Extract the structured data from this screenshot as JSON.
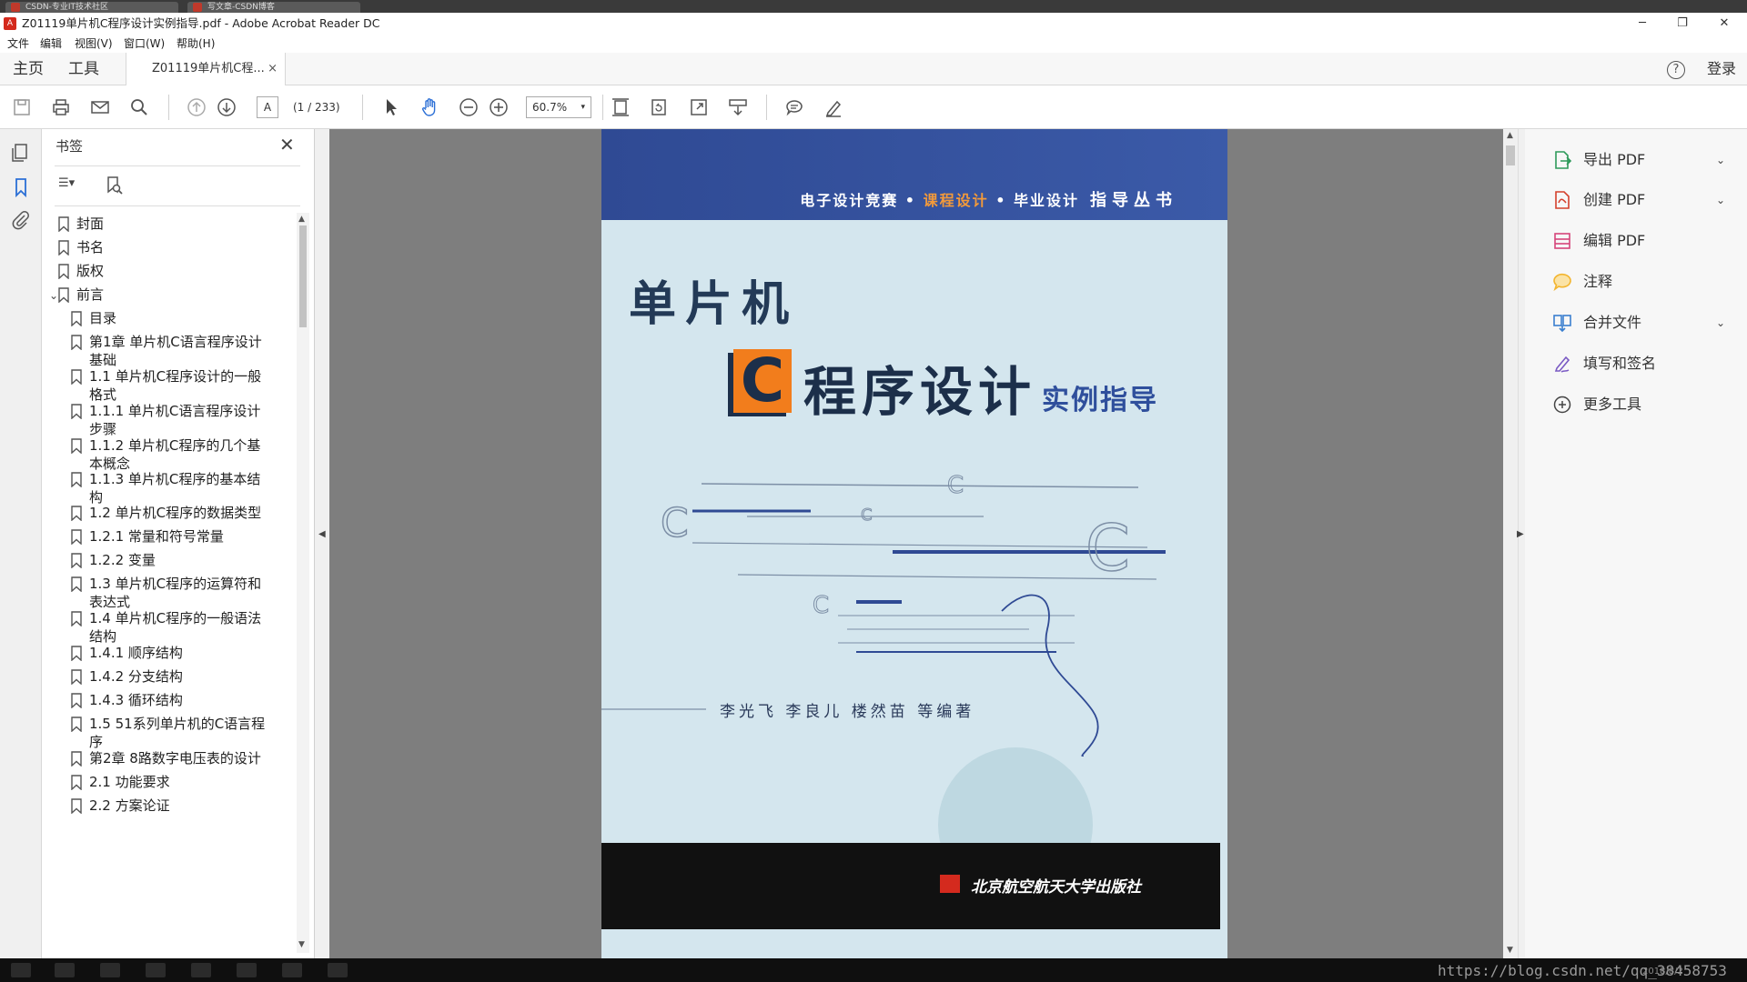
{
  "browser": {
    "tabs": [
      {
        "label": "CSDN-专业IT技术社区"
      },
      {
        "label": "写文章-CSDN博客"
      }
    ]
  },
  "window": {
    "title": "Z01119单片机C程序设计实例指导.pdf - Adobe Acrobat Reader DC",
    "minimize": "─",
    "restore": "❐",
    "close": "✕"
  },
  "menu": [
    "文件",
    "编辑",
    "视图(V)",
    "窗口(W)",
    "帮助(H)"
  ],
  "tabs": {
    "home": "主页",
    "tools": "工具",
    "document": "Z01119单片机C程...",
    "document_close": "×",
    "help": "?",
    "login": "登录"
  },
  "toolbar": {
    "page_input": "A",
    "page_count": "(1 / 233)",
    "zoom": "60.7%",
    "zoom_caret": "▾"
  },
  "bookmarks": {
    "title": "书签",
    "close": "✕",
    "options": "☰▾",
    "items": [
      {
        "label": "封面"
      },
      {
        "label": "书名"
      },
      {
        "label": "版权"
      },
      {
        "label": "前言",
        "expanded": true
      },
      {
        "label": "目录"
      },
      {
        "label": "第1章 单片机C语言程序设计基础"
      },
      {
        "label": "1.1 单片机C程序设计的一般格式"
      },
      {
        "label": "1.1.1 单片机C语言程序设计步骤"
      },
      {
        "label": "1.1.2 单片机C程序的几个基本概念"
      },
      {
        "label": "1.1.3 单片机C程序的基本结构"
      },
      {
        "label": "1.2 单片机C程序的数据类型"
      },
      {
        "label": "1.2.1 常量和符号常量"
      },
      {
        "label": "1.2.2 变量"
      },
      {
        "label": "1.3 单片机C程序的运算符和表达式"
      },
      {
        "label": "1.4 单片机C程序的一般语法结构"
      },
      {
        "label": "1.4.1 顺序结构"
      },
      {
        "label": "1.4.2 分支结构"
      },
      {
        "label": "1.4.3 循环结构"
      },
      {
        "label": "1.5 51系列单片机的C语言程序"
      },
      {
        "label": "第2章 8路数字电压表的设计"
      },
      {
        "label": "2.1 功能要求"
      },
      {
        "label": "2.2 方案论证"
      }
    ]
  },
  "cover": {
    "series_a": "电子设计竞赛 • ",
    "series_b": "课程设计",
    "series_c": " • 毕业设计",
    "series_d": "指导丛书",
    "title_line1": "单片机",
    "title_c": "C",
    "title_line2": "程序设计",
    "title_line3": "实例指导",
    "authors": "李光飞  李良儿  楼然苗    等编著",
    "publisher": "北京航空航天大学出版社"
  },
  "tools_pane": [
    {
      "label": "导出 PDF",
      "icon": "export-pdf-icon",
      "color": "#2e9a5a",
      "chevron": "⌄"
    },
    {
      "label": "创建 PDF",
      "icon": "create-pdf-icon",
      "color": "#d4402c",
      "chevron": "⌄"
    },
    {
      "label": "编辑 PDF",
      "icon": "edit-pdf-icon",
      "color": "#d6457a",
      "chevron": ""
    },
    {
      "label": "注释",
      "icon": "comment-icon",
      "color": "#f3b52e",
      "chevron": ""
    },
    {
      "label": "合并文件",
      "icon": "combine-files-icon",
      "color": "#3a7fcf",
      "chevron": "⌄"
    },
    {
      "label": "填写和签名",
      "icon": "fill-sign-icon",
      "color": "#7a5ac4",
      "chevron": ""
    },
    {
      "label": "更多工具",
      "icon": "more-tools-icon",
      "color": "#444444",
      "chevron": ""
    }
  ],
  "taskbar": {
    "watermark": "https://blog.csdn.net/qq_38458753",
    "date": "2018/8/2"
  },
  "colors": {
    "accent": "#2b6fd6",
    "cover_blue": "#3b5aa8",
    "cover_orange": "#f27d1c"
  }
}
